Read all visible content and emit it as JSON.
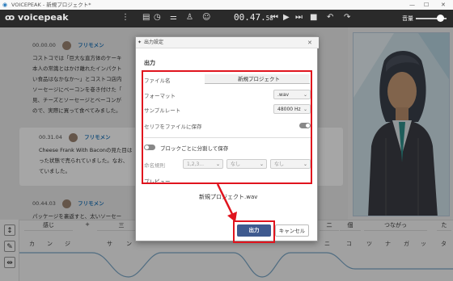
{
  "window": {
    "title": "VOICEPEAK - 新規プロジェクト*",
    "min": "—",
    "max": "☐",
    "close": "✕"
  },
  "appbar": {
    "logo": "voicepeak",
    "time_main": "00.47.",
    "time_frac": "58",
    "volume_label": "音量",
    "volume_level": 0.7
  },
  "blocks": [
    {
      "time": "00.00.00",
      "speaker": "フリモメン",
      "lines": [
        "コストコでは「巨大な直方体のケーキ",
        "本人の常識とはかけ離れたインパクト",
        "い食品はなかなか～」とコストコ店内",
        "ソーセージにベーコンを巻き付けた「",
        "見、チーズとソーセージとベーコンが",
        "ので、実際に買って食べてみました。"
      ]
    },
    {
      "time": "00.31.04",
      "speaker": "フリモメン",
      "lines": [
        "Cheese Frank With Baconの見た目は",
        "った状態で売られていました。なお、",
        "ていました。"
      ]
    },
    {
      "time": "00.44.03",
      "speaker": "フリモメン",
      "lines": [
        "パッケージを裏返すと、太いソーセー"
      ]
    }
  ],
  "bottom": {
    "phrases": [
      "感じ",
      "三",
      "二",
      "個",
      "つながっ",
      "た"
    ],
    "moras": [
      "カ",
      "ン",
      "ジ",
      "サ",
      "ン",
      "ニ",
      "コ",
      "ツ",
      "ナ",
      "ガ",
      "ッ",
      "タ"
    ],
    "plus": "+"
  },
  "dialog": {
    "title": "出力設定",
    "close": "✕",
    "section": "出力",
    "filename_label": "ファイル名",
    "filename_value": "新規プロジェクト",
    "format_label": "フォーマット",
    "format_value": ".wav",
    "samplerate_label": "サンプルレート",
    "samplerate_value": "48000 Hz",
    "save_script_label": "セリフをファイルに保存",
    "split_label": "ブロックごとに分割して保存",
    "naming_label": "命名規則",
    "naming_options": [
      "1,2,3...",
      "なし",
      "なし"
    ],
    "preview_label": "プレビュー",
    "preview_value": "新規プロジェクト.wav",
    "ok_label": "出力",
    "cancel_label": "キャンセル"
  },
  "colors": {
    "highlight": "#e0141e",
    "ok_button": "#3f5a8f",
    "appbar": "#2a2a2a",
    "speaker_name": "#2277bb"
  }
}
